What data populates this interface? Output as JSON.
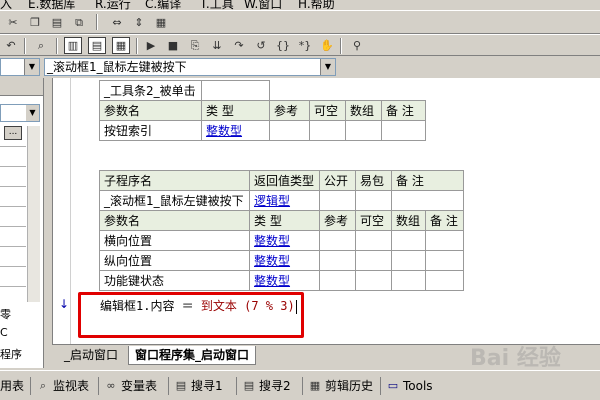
{
  "menubar": {
    "items": [
      "入",
      "E.数据库",
      "R.运行",
      "C.编译",
      "T.工具",
      "W.窗口",
      "H.帮助"
    ]
  },
  "toolbar": {
    "row1_icons": [
      "cut-icon",
      "copy-icon",
      "paste-icon",
      "undo-icon"
    ],
    "row2_icons": [
      "undo-icon",
      "find-icon",
      "layout-icon",
      "window-icon",
      "table-icon",
      "run-icon",
      "stop-icon",
      "step-icon",
      "step-into-icon",
      "step-out-icon",
      "brace-icon",
      "hand-icon",
      "binoculars-icon"
    ]
  },
  "combo": {
    "left_value": "",
    "main_value": "_滚动框1_鼠标左键被按下"
  },
  "left_panel": {
    "dot_button": "...",
    "label_1": "零",
    "label_2": "C",
    "label_3": "程序"
  },
  "table1": {
    "title": "_工具条2_被单击",
    "headers": [
      "参数名",
      "类 型",
      "参考",
      "可空",
      "数组",
      "备 注"
    ],
    "rows": [
      [
        "按钮索引",
        "整数型",
        "",
        "",
        "",
        ""
      ]
    ]
  },
  "table2": {
    "headers": [
      "子程序名",
      "返回值类型",
      "公开",
      "易包",
      "备 注"
    ],
    "sub": [
      "_滚动框1_鼠标左键被按下",
      "逻辑型",
      "",
      "",
      ""
    ],
    "param_headers": [
      "参数名",
      "类 型",
      "参考",
      "可空",
      "数组",
      "备 注"
    ],
    "params": [
      [
        "横向位置",
        "整数型",
        "",
        "",
        "",
        ""
      ],
      [
        "纵向位置",
        "整数型",
        "",
        "",
        "",
        ""
      ],
      [
        "功能键状态",
        "整数型",
        "",
        "",
        "",
        ""
      ]
    ]
  },
  "code": {
    "marker": "↓",
    "line_prefix": "编辑框1.内容 ＝ ",
    "line_func": "到文本 (7 % 3)"
  },
  "tabs": {
    "inactive": "_启动窗口",
    "active": "窗口程序集_启动窗口"
  },
  "bottom_tabs": [
    "用表",
    "监视表",
    "变量表",
    "搜寻1",
    "搜寻2",
    "剪辑历史",
    "Tools"
  ],
  "watermark": "Bai 经验"
}
